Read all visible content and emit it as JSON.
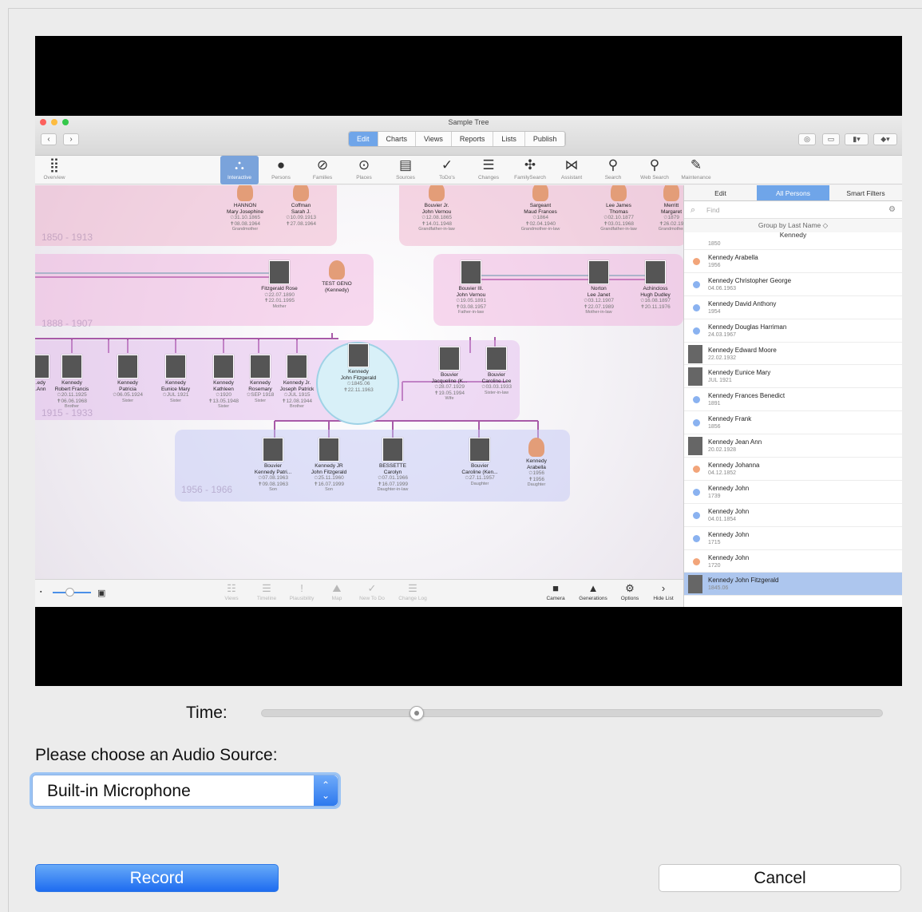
{
  "window": {
    "title": "Sample Tree"
  },
  "tabs": [
    {
      "label": "Edit",
      "active": true
    },
    {
      "label": "Charts"
    },
    {
      "label": "Views"
    },
    {
      "label": "Reports"
    },
    {
      "label": "Lists"
    },
    {
      "label": "Publish"
    }
  ],
  "nav": {
    "back": "‹",
    "forward": "›"
  },
  "toolbar": [
    {
      "label": "Overview",
      "icon": "grid-icon"
    },
    {
      "label": "Interactive",
      "icon": "interactive-tree-icon",
      "active": true
    },
    {
      "label": "Persons",
      "icon": "person-icon"
    },
    {
      "label": "Families",
      "icon": "families-icon"
    },
    {
      "label": "Places",
      "icon": "pin-icon"
    },
    {
      "label": "Sources",
      "icon": "sources-icon"
    },
    {
      "label": "ToDo's",
      "icon": "check-circle-icon"
    },
    {
      "label": "Changes",
      "icon": "list-icon"
    },
    {
      "label": "FamilySearch",
      "icon": "familysearch-icon"
    },
    {
      "label": "Assistant",
      "icon": "assistant-icon"
    },
    {
      "label": "Search",
      "icon": "search-icon"
    },
    {
      "label": "Web Search",
      "icon": "web-search-icon"
    },
    {
      "label": "Maintenance",
      "icon": "maintenance-icon"
    }
  ],
  "eras": [
    "1850 - 1913",
    "1888 - 1907",
    "1915 - 1933",
    "1956 - 1966"
  ],
  "tree": {
    "gen1": [
      {
        "name": "HANNON\nMary Josephine",
        "dates": "✩31.10.1865\n✝08.08.1964",
        "role": "Grandmother"
      },
      {
        "name": "Coffman\nSarah J.",
        "dates": "✩10.09.1913\n✝27.08.1964",
        "role": ""
      },
      {
        "name": "Bouvier Jr.\nJohn Vernou",
        "dates": "✩12.08.1865\n✝14.01.1948",
        "role": "Grandfather-in-law"
      },
      {
        "name": "Sargeant\nMaud Frances",
        "dates": "✩1864\n✝02.04.1940",
        "role": "Grandmother-in-law"
      },
      {
        "name": "Lee James\nThomas",
        "dates": "✩02.10.1877\n✝03.01.1968",
        "role": "Grandfather-in-law"
      },
      {
        "name": "Merritt\nMargaret",
        "dates": "✩1879\n✝26.02.19",
        "role": "Grandmother"
      }
    ],
    "gen2": [
      {
        "name": "Fitzgerald Rose",
        "dates": "✩22.07.1890\n✝22.01.1995",
        "role": "Mother"
      },
      {
        "name": "TEST GENO\n(Kennedy)",
        "dates": "",
        "role": ""
      },
      {
        "name": "Bouvier III.\nJohn Vernou",
        "dates": "✩19.05.1891\n✝03.08.1957",
        "role": "Father-in-law"
      },
      {
        "name": "Norton\nLee Janet",
        "dates": "✩03.12.1907\n✝22.07.1989",
        "role": "Mother-in-law"
      },
      {
        "name": "Achincloss\nHugh Dudley",
        "dates": "✩16.08.1897\n✝20.11.1976",
        "role": ""
      }
    ],
    "gen3": [
      {
        "name": "...edy\n...Ann",
        "dates": "",
        "role": ""
      },
      {
        "name": "Kennedy\nRobert Francis",
        "dates": "✩20.11.1925\n✝06.06.1968",
        "role": "Brother"
      },
      {
        "name": "Kennedy\nPatricia",
        "dates": "✩06.05.1924",
        "role": "Sister"
      },
      {
        "name": "Kennedy\nEunice Mary",
        "dates": "✩JUL 1921",
        "role": "Sister"
      },
      {
        "name": "Kennedy\nKathleen",
        "dates": "✩1920\n✝13.05.1948",
        "role": "Sister"
      },
      {
        "name": "Kennedy\nRosemary",
        "dates": "✩SEP 1918",
        "role": "Sister"
      },
      {
        "name": "Kennedy Jr.\nJoseph Patrick",
        "dates": "✩JUL 1915\n✝12.08.1944",
        "role": "Brother"
      }
    ],
    "focus": {
      "name": "Kennedy\nJohn Fitzgerald",
      "dates": "✩1845.06\n✝22.11.1963"
    },
    "spouse": [
      {
        "name": "Bouvier\nJacqueline (K...",
        "dates": "✩28.07.1929\n✝19.05.1994",
        "role": "Wife"
      },
      {
        "name": "Bouvier\nCaroline Lee",
        "dates": "✩03.03.1933",
        "role": "Sister-in-law"
      }
    ],
    "gen4": [
      {
        "name": "Bouvier\nKennedy Patri...",
        "dates": "✩07.08.1963\n✝09.08.1963",
        "role": "Son"
      },
      {
        "name": "Kennedy JR\nJohn Fitzgerald",
        "dates": "✩25.11.1960\n✝16.07.1999",
        "role": "Son"
      },
      {
        "name": "BESSETTE\nCarolyn",
        "dates": "✩07.01.1966\n✝16.07.1999",
        "role": "Daughter-in-law"
      },
      {
        "name": "Bouvier\nCaroline (Ken...",
        "dates": "✩27.11.1957",
        "role": "Daughter"
      },
      {
        "name": "Kennedy\nArabella",
        "dates": "✩1956\n✝1956",
        "role": "Daughter"
      }
    ]
  },
  "sidebar": {
    "tabs": [
      "Edit",
      "All Persons",
      "Smart Filters"
    ],
    "find_placeholder": "Find",
    "group_by": "Group by Last Name ◇",
    "section": "Kennedy",
    "first_year": "1850",
    "persons": [
      {
        "name": "Kennedy Arabella",
        "year": "1956",
        "marker": "#f2a57a"
      },
      {
        "name": "Kennedy Christopher George",
        "year": "04.06.1963",
        "marker": "#8ab2f0"
      },
      {
        "name": "Kennedy David Anthony",
        "year": "1954",
        "marker": "#8ab2f0"
      },
      {
        "name": "Kennedy Douglas Harriman",
        "year": "24.03.1967",
        "marker": "#8ab2f0"
      },
      {
        "name": "Kennedy Edward Moore",
        "year": "22.02.1932",
        "marker": "photo"
      },
      {
        "name": "Kennedy Eunice Mary",
        "year": "JUL 1921",
        "marker": "photo"
      },
      {
        "name": "Kennedy Frances Benedict",
        "year": "1891",
        "marker": "#8ab2f0"
      },
      {
        "name": "Kennedy Frank",
        "year": "1856",
        "marker": "#8ab2f0"
      },
      {
        "name": "Kennedy Jean Ann",
        "year": "20.02.1928",
        "marker": "photo"
      },
      {
        "name": "Kennedy Johanna",
        "year": "04.12.1852",
        "marker": "#f2a57a"
      },
      {
        "name": "Kennedy John",
        "year": "1739",
        "marker": "#8ab2f0"
      },
      {
        "name": "Kennedy John",
        "year": "04.01.1854",
        "marker": "#8ab2f0"
      },
      {
        "name": "Kennedy John",
        "year": "1715",
        "marker": "#8ab2f0"
      },
      {
        "name": "Kennedy John",
        "year": "1720",
        "marker": "#f2a57a"
      },
      {
        "name": "Kennedy John Fitzgerald",
        "year": "1845.06",
        "marker": "photo",
        "selected": true
      }
    ]
  },
  "bottombar": [
    {
      "label": "Views",
      "icon": "views-icon",
      "dim": true
    },
    {
      "label": "Timeline",
      "icon": "timeline-icon",
      "dim": true
    },
    {
      "label": "Plausibility",
      "icon": "exclamation-icon",
      "dim": true
    },
    {
      "label": "Map",
      "icon": "map-icon",
      "dim": true
    },
    {
      "label": "New To Do",
      "icon": "checkmark-icon",
      "dim": true
    },
    {
      "label": "Change Log",
      "icon": "changelog-icon",
      "dim": true
    },
    {
      "label": "Camera",
      "icon": "camera-icon"
    },
    {
      "label": "Generations",
      "icon": "generations-icon"
    },
    {
      "label": "Options",
      "icon": "gear-icon"
    },
    {
      "label": "Hide List",
      "icon": "chevron-right-icon"
    }
  ],
  "time_label": "Time:",
  "time_progress": 0.25,
  "audio_label": "Please choose an Audio Source:",
  "audio_source": "Built-in Microphone",
  "record_label": "Record",
  "cancel_label": "Cancel"
}
